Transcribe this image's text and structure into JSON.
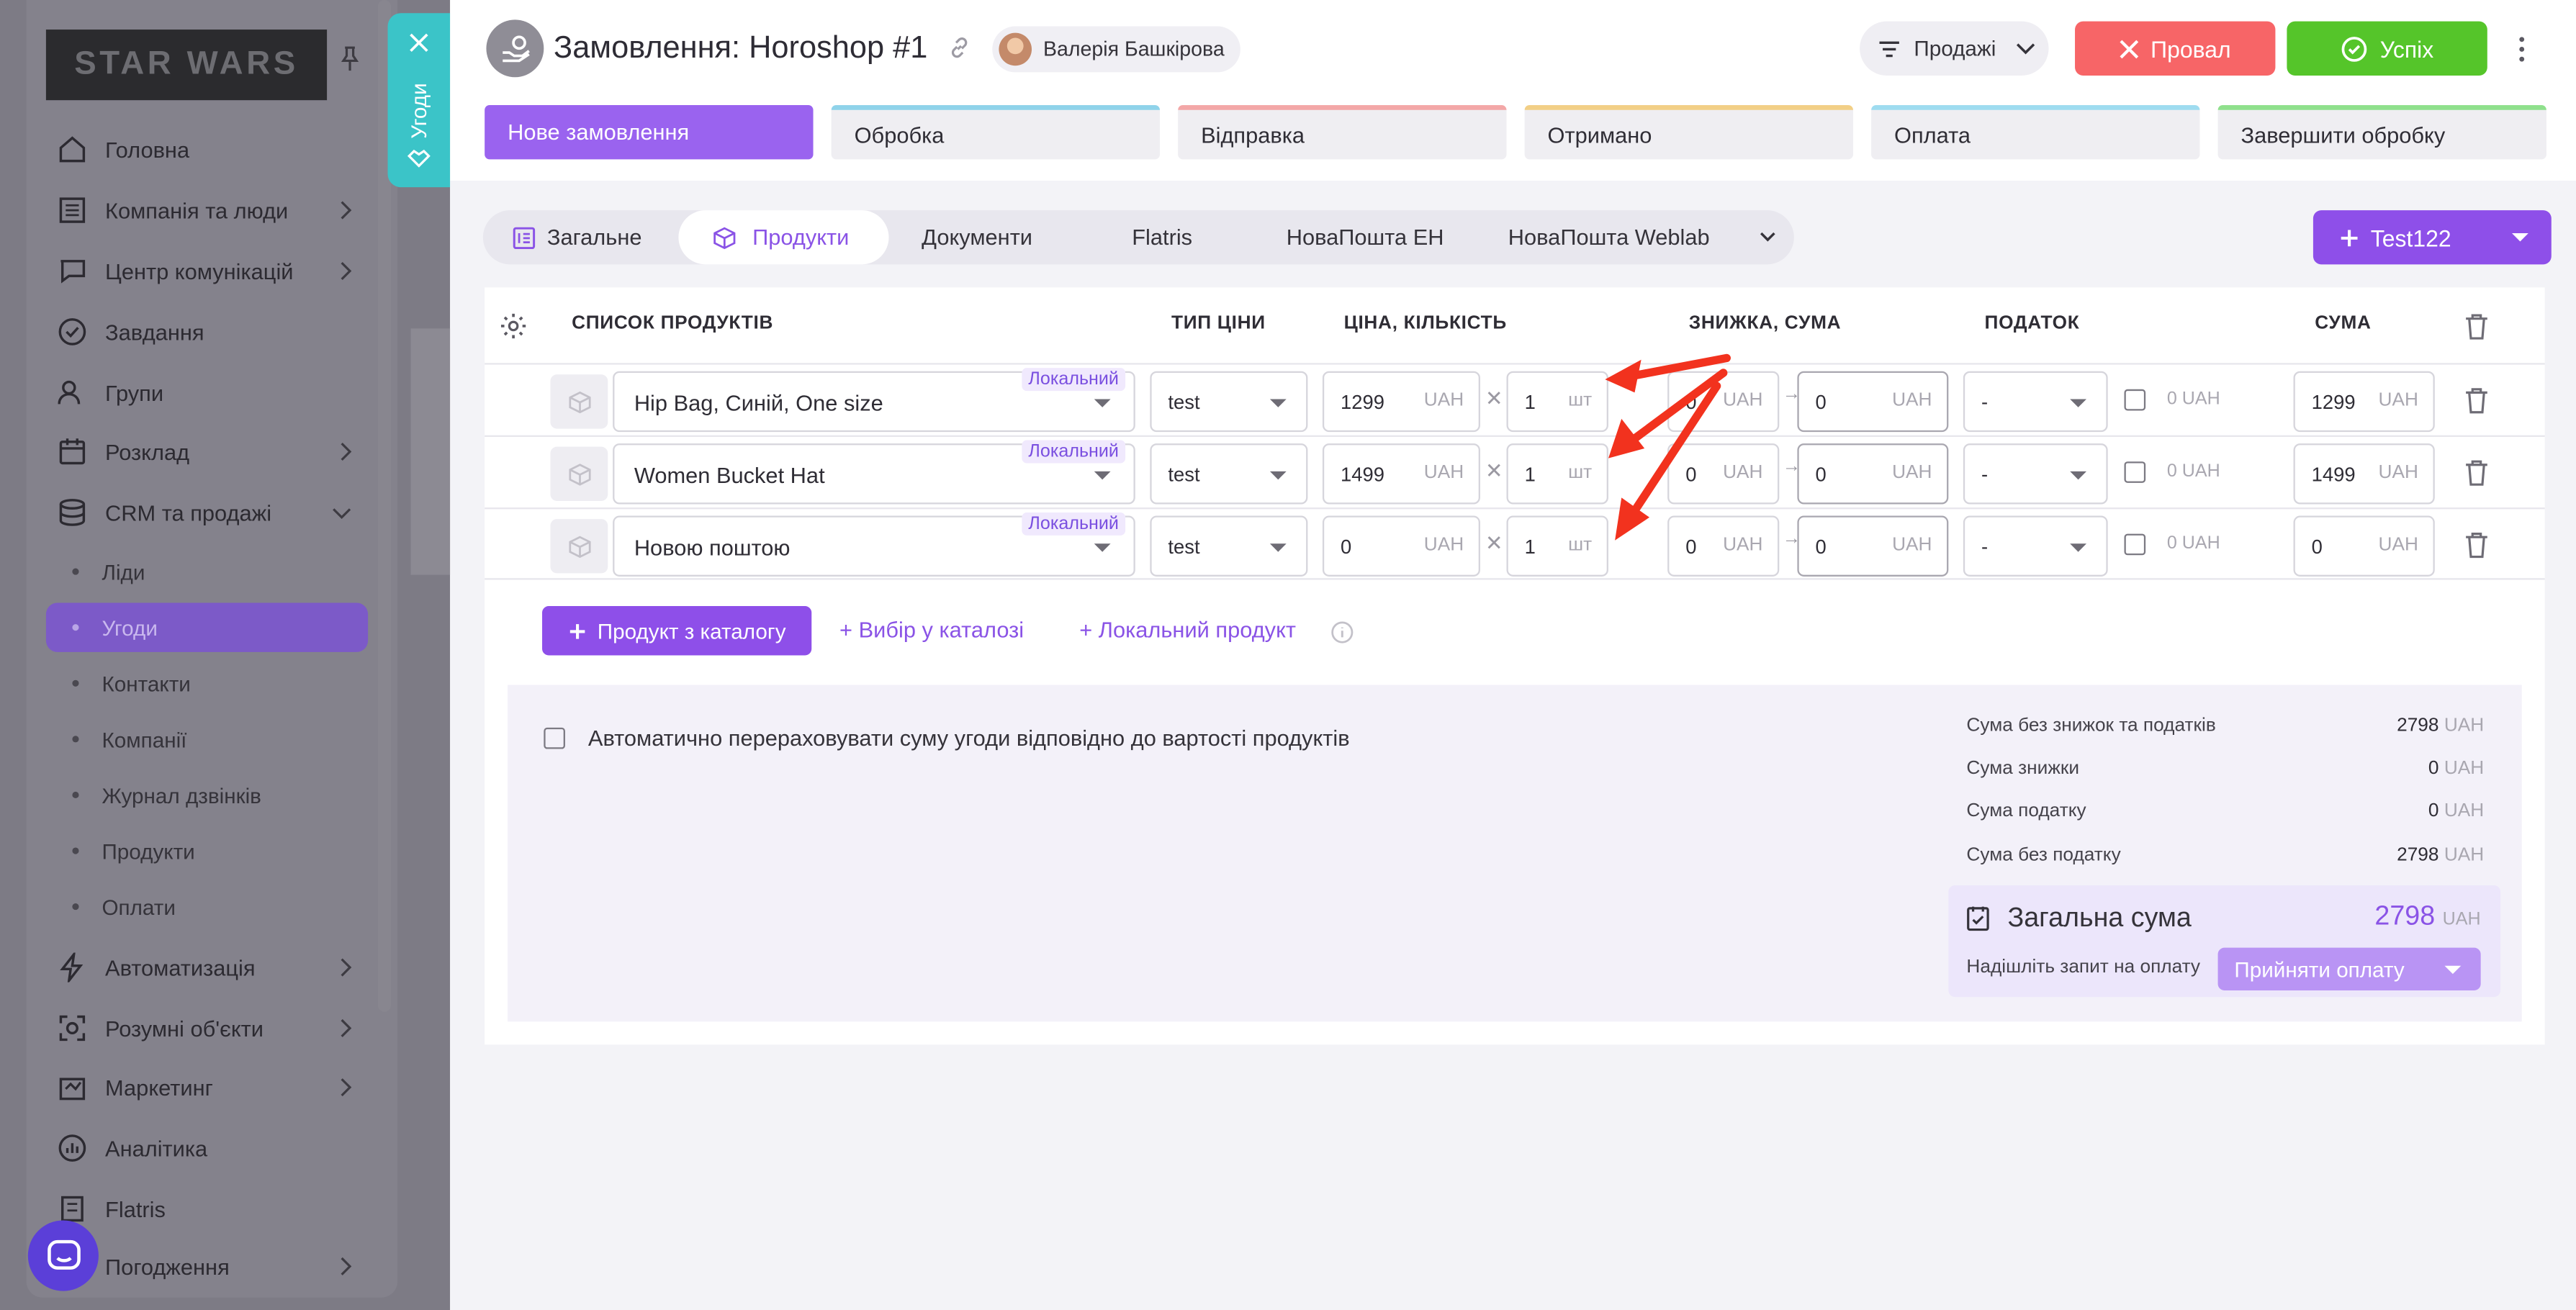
{
  "sidebar": {
    "logo": "STAR WARS",
    "items": [
      {
        "label": "Головна",
        "icon": "home-icon"
      },
      {
        "label": "Компанія та люди",
        "icon": "company-icon"
      },
      {
        "label": "Центр комунікацій",
        "icon": "chat-icon"
      },
      {
        "label": "Завдання",
        "icon": "check-circle-icon"
      },
      {
        "label": "Групи",
        "icon": "users-icon"
      },
      {
        "label": "Розклад",
        "icon": "calendar-icon"
      },
      {
        "label": "CRM та продажі",
        "icon": "database-icon"
      }
    ],
    "crm_sub": [
      "Ліди",
      "Угоди",
      "Контакти",
      "Компанії",
      "Журнал дзвінків",
      "Продукти",
      "Оплати"
    ],
    "items2": [
      {
        "label": "Автоматизація",
        "icon": "lightning-icon"
      },
      {
        "label": "Розумні об'єкти",
        "icon": "smart-object-icon"
      },
      {
        "label": "Маркетинг",
        "icon": "marketing-icon"
      },
      {
        "label": "Аналітика",
        "icon": "analytics-icon"
      },
      {
        "label": "Flatris",
        "icon": "flatris-icon"
      },
      {
        "label": "Погодження",
        "icon": "approval-icon"
      }
    ]
  },
  "drawer_tab": {
    "label": "Угоди"
  },
  "header": {
    "title": "Замовлення: Horoshop #1",
    "user": "Валерія Башкірова",
    "pipeline": "Продажі",
    "fail": "Провал",
    "success": "Успіх"
  },
  "stages": [
    {
      "label": "Нове замовлення",
      "color": "#9a63ef"
    },
    {
      "label": "Обробка",
      "color": "#8fd3ea"
    },
    {
      "label": "Відправка",
      "color": "#f3a7a7"
    },
    {
      "label": "Отримано",
      "color": "#f2cf86"
    },
    {
      "label": "Оплата",
      "color": "#9edcf0"
    },
    {
      "label": "Завершити обробку",
      "color": "#8fe08c"
    }
  ],
  "tabs": [
    "Загальне",
    "Продукти",
    "Документи",
    "Flatris",
    "НоваПошта ЕН",
    "НоваПошта Weblab"
  ],
  "add_button": "Test122",
  "table": {
    "headers": [
      "СПИСОК ПРОДУКТІВ",
      "ТИП ЦІНИ",
      "ЦІНА, КІЛЬКІСТЬ",
      "ЗНИЖКА, СУМА",
      "ПОДАТОК",
      "СУМА"
    ],
    "rows": [
      {
        "name": "Hip Bag, Синій, One size",
        "badge": "Локальний",
        "price_type": "test",
        "price": "1299",
        "currency": "UAH",
        "qty": "1",
        "unit": "шт",
        "disc": "0",
        "disc_sum": "0",
        "tax": "-",
        "tax_sum": "0 UAH",
        "total": "1299"
      },
      {
        "name": "Women Bucket Hat",
        "badge": "Локальний",
        "price_type": "test",
        "price": "1499",
        "currency": "UAH",
        "qty": "1",
        "unit": "шт",
        "disc": "0",
        "disc_sum": "0",
        "tax": "-",
        "tax_sum": "0 UAH",
        "total": "1499"
      },
      {
        "name": "Новою поштою",
        "badge": "Локальний",
        "price_type": "test",
        "price": "0",
        "currency": "UAH",
        "qty": "1",
        "unit": "шт",
        "disc": "0",
        "disc_sum": "0",
        "tax": "-",
        "tax_sum": "0 UAH",
        "total": "0"
      }
    ]
  },
  "actions": {
    "catalog": "Продукт з каталогу",
    "choose": "Вибір у каталозі",
    "local": "Локальний продукт"
  },
  "summary": {
    "auto": "Автоматично перераховувати суму угоди відповідно до вартості продуктів",
    "rows": [
      {
        "label": "Сума без знижок та податків",
        "value": "2798",
        "cur": "UAH"
      },
      {
        "label": "Сума знижки",
        "value": "0",
        "cur": "UAH"
      },
      {
        "label": "Сума податку",
        "value": "0",
        "cur": "UAH"
      },
      {
        "label": "Сума без податку",
        "value": "2798",
        "cur": "UAH"
      }
    ],
    "total_label": "Загальна сума",
    "total_value": "2798",
    "total_cur": "UAH",
    "pay_request": "Надішліть запит на оплату",
    "pay_button": "Прийняти оплату"
  },
  "colors": {
    "accent": "#8e4fe9",
    "fail": "#f76567",
    "success": "#55c52a",
    "drawer": "#3bc4c8"
  }
}
